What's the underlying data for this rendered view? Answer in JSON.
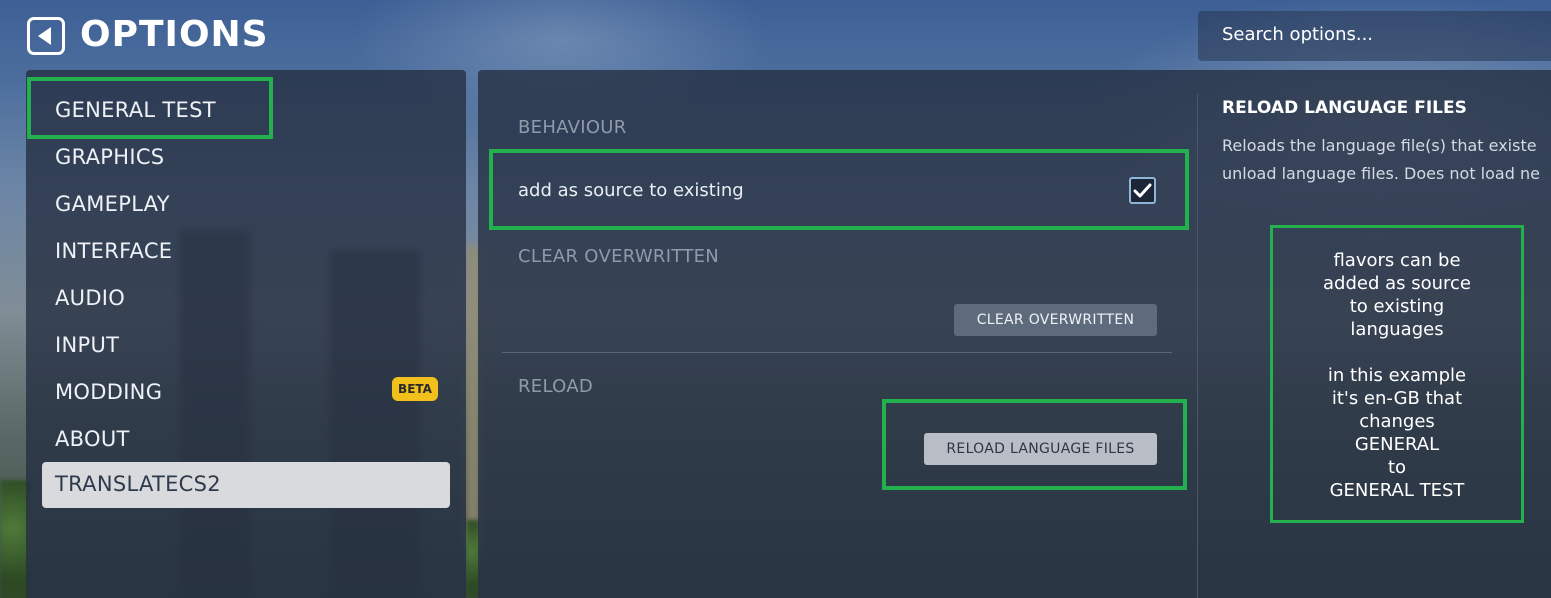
{
  "header": {
    "title": "OPTIONS",
    "search_placeholder": "Search options..."
  },
  "sidebar": {
    "items": [
      {
        "label": "GENERAL TEST"
      },
      {
        "label": "GRAPHICS"
      },
      {
        "label": "GAMEPLAY"
      },
      {
        "label": "INTERFACE"
      },
      {
        "label": "AUDIO"
      },
      {
        "label": "INPUT"
      },
      {
        "label": "MODDING",
        "badge": "BETA"
      },
      {
        "label": "ABOUT"
      },
      {
        "label": "TRANSLATECS2",
        "selected": true
      }
    ]
  },
  "content": {
    "sections": {
      "behaviour": "BEHAVIOUR",
      "clear_overwritten": "CLEAR OVERWRITTEN",
      "reload": "RELOAD"
    },
    "add_as_source_label": "add as source to existing",
    "add_as_source_checked": true,
    "clear_overwritten_button": "CLEAR OVERWRITTEN",
    "reload_button": "RELOAD LANGUAGE FILES"
  },
  "description": {
    "title": "RELOAD LANGUAGE FILES",
    "line1": "Reloads the language file(s) that existe",
    "line2": "unload language files. Does not load ne"
  },
  "annotation": {
    "lines": [
      "flavors can be",
      "added as source",
      "to existing",
      "languages",
      "",
      "in this example",
      "it's en-GB that",
      "changes",
      "GENERAL",
      "to",
      "GENERAL TEST"
    ],
    "highlight_color": "#22b14c"
  },
  "colors": {
    "accent_highlight": "#22b14c",
    "beta_badge": "#f2c01a",
    "panel": "#263042"
  }
}
